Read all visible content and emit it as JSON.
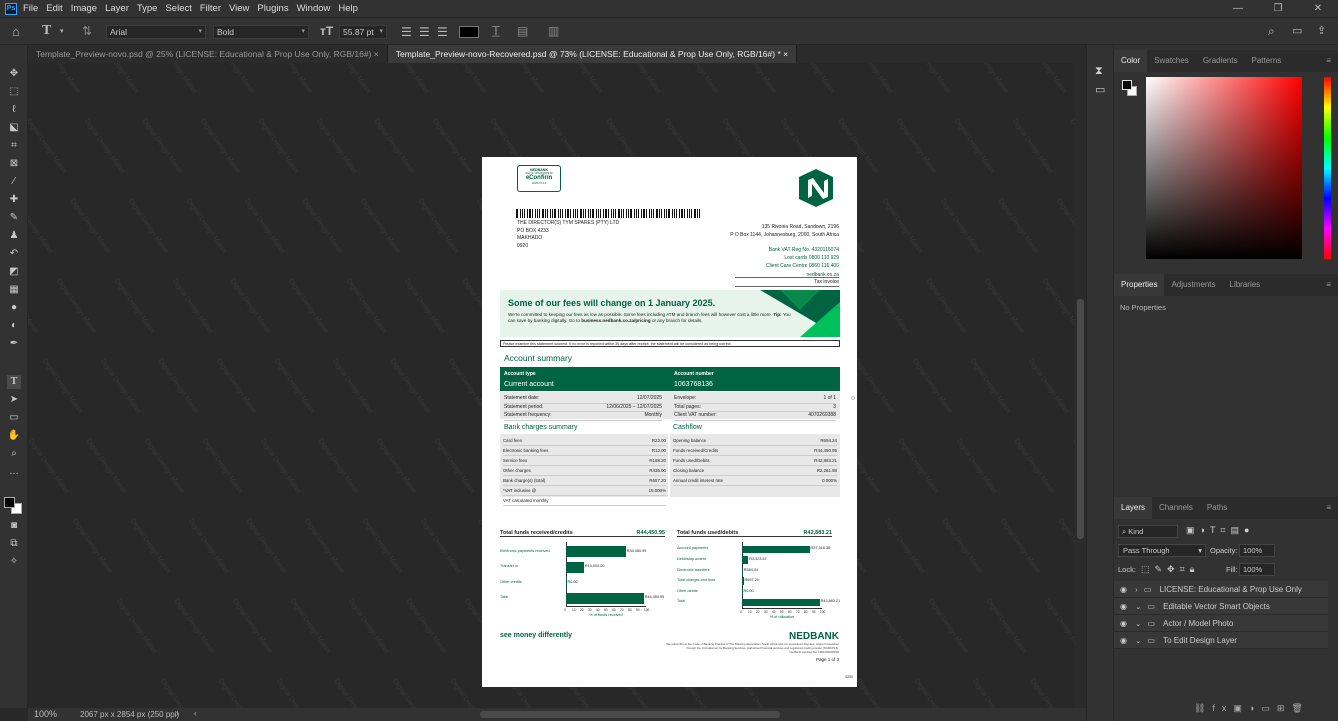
{
  "menubar": {
    "items": [
      "File",
      "Edit",
      "Image",
      "Layer",
      "Type",
      "Select",
      "Filter",
      "View",
      "Plugins",
      "Window",
      "Help"
    ]
  },
  "options": {
    "font_family": "Arial",
    "font_style": "Bold",
    "font_size": "55.87 pt",
    "text_color": "#000000"
  },
  "tabs": [
    {
      "label": "Template_Preview-novo.psd @ 25% (LICENSE: Educational & Prop Use Only, RGB/16#)",
      "close": "×"
    },
    {
      "label": "Template_Preview-novo-Recovered.psd @ 73% (LICENSE: Educational & Prop Use Only, RGB/16#) *",
      "close": "×"
    }
  ],
  "status": {
    "zoom": "100%",
    "doc_info": "2067 px x 2854 px (250 ppi)"
  },
  "watermark": "Digital Design Maker",
  "panels": {
    "color_tabs": [
      "Color",
      "Swatches",
      "Gradients",
      "Patterns"
    ],
    "props_tabs": [
      "Properties",
      "Adjustments",
      "Libraries"
    ],
    "props_empty": "No Properties",
    "layers_tabs": [
      "Layers",
      "Channels",
      "Paths"
    ],
    "kind": "Kind",
    "blend": "Pass Through",
    "opacity_label": "Opacity:",
    "opacity": "100%",
    "lock_label": "Lock:",
    "fill_label": "Fill:",
    "fill": "100%",
    "layers": [
      "LICENSE: Educational & Prop Use Only",
      "Editable Vector Smart Objects",
      "Actor / Model Photo",
      "To Edit Design Layer"
    ]
  },
  "document": {
    "badge_bank": "NEDBANK",
    "badge_sub": "Reg No 1951/000009/06",
    "badge_title": "eConfirm",
    "badge_date": "2025-07-15",
    "recipient": [
      "THE DIRECTOR(S) TYM SPARES (PTY) LTD",
      "PO BOX 4233",
      "MAKHADO",
      "0920"
    ],
    "bank_address": [
      "135 Rivonia Road, Sandown, 2196",
      "P O Box 1144, Johannesburg, 2000, South Africa"
    ],
    "bank_contacts": [
      "Bank VAT Reg No. 4320116074",
      "Lost cards 0800 110 929",
      "Client Care Centre 0860 116 400",
      "nedbank.co.za"
    ],
    "tax_invoice": "Tax invoice",
    "banner_title": "Some of our fees will change on 1 January 2025.",
    "banner_text_1": "We're committed to keeping our fees as low as possible. Some fees including ATM and branch fees will however cost a little more.",
    "banner_tip_label": "Tip:",
    "banner_text_2": "You can save by banking digitally. Go to",
    "banner_link": "business.nedbank.co.za/pricing",
    "banner_text_3": "or any branch for details.",
    "notice": "Please examine this statement soonest. If no error is reported within 30 days after receipt, the statement will be considered as being correct.",
    "acct_summary_title": "Account summary",
    "acct_type_label": "Account type",
    "acct_type": "Current account",
    "acct_num_label": "Account number",
    "acct_num": "1063768136",
    "stmt_left": [
      [
        "Statement date:",
        "12/07/2025"
      ],
      [
        "Statement period:",
        "12/06/2025 – 12/07/2025"
      ],
      [
        "Statement frequency:",
        "Monthly"
      ]
    ],
    "stmt_right": [
      [
        "Envelope:",
        "1 of 1"
      ],
      [
        "Total pages:",
        "3"
      ],
      [
        "Client VAT number:",
        "4070269388"
      ]
    ],
    "charges_title": "Bank charges summary",
    "charges": [
      [
        "Card fees",
        "R22.00"
      ],
      [
        "Electronic banking fees",
        "R12.00"
      ],
      [
        "Service fees",
        "R188.20"
      ],
      [
        "Other charges",
        "R435.00"
      ],
      [
        "Bank charge(s) (total)",
        "R657.20"
      ],
      [
        "*VAT inclusive @",
        "15.000%"
      ],
      [
        "VAT calculated monthly",
        ""
      ]
    ],
    "cashflow_title": "Cashflow",
    "cashflow": [
      [
        "Opening balance",
        "R694.24"
      ],
      [
        "Funds received/Credits",
        "R44,450.95"
      ],
      [
        "Funds used/Debits",
        "R42,883.21"
      ],
      [
        "Closing balance",
        "R2,261.98"
      ],
      [
        "Annual credit interest rate",
        "0.000%"
      ]
    ],
    "credits_title": "Total funds received/credits",
    "credits_total": "R44,450.95",
    "credits_xlabel": "% of funds received",
    "credits_ticks": [
      "0",
      "10",
      "20",
      "30",
      "40",
      "50",
      "60",
      "70",
      "80",
      "90",
      "100"
    ],
    "debits_title": "Total funds used/debits",
    "debits_total": "R42,883.21",
    "debits_xlabel": "% of utilisation",
    "debits_ticks": [
      "0",
      "10",
      "20",
      "30",
      "40",
      "50",
      "60",
      "70",
      "80",
      "90",
      "100"
    ],
    "slogan": "see money differently",
    "footer_brand": "NEDBANK",
    "footer_legal": [
      "We subscribe to the Code of Banking Practice of The Banking Association South Africa and, for unresolved disputes, support resolution",
      "through the Ombudsman for Banking Services. Authorised financial services and registered credit provider (NCRCP16).",
      "Nedbank Ltd Reg No. 1951/000009/06"
    ],
    "page": "Page 1 of 3",
    "code": "0200"
  },
  "chart_data": [
    {
      "type": "bar",
      "title": "Total funds received/credits",
      "xlabel": "% of funds received",
      "xlim": [
        0,
        100
      ],
      "categories": [
        "Electronic payments received",
        "Transfer in",
        "Other credits",
        "Total"
      ],
      "values": [
        77,
        23,
        0,
        100
      ],
      "labels": [
        "R34,450.95",
        "R10,000.00",
        "R0.00",
        "R44,450.95"
      ]
    },
    {
      "type": "bar",
      "title": "Total funds used/debits",
      "xlabel": "% of utilisation",
      "xlim": [
        0,
        100
      ],
      "categories": [
        "Account payments",
        "Debit/stop orders",
        "Electronic transfers",
        "Total charges and fees",
        "Other debits",
        "Total"
      ],
      "values": [
        87,
        8,
        1,
        2,
        0,
        100
      ],
      "labels": [
        "R37,318.38",
        "R3,323.67",
        "R584.04",
        "R657.20",
        "R0.00",
        "R42,883.21"
      ]
    }
  ],
  "colors": {
    "brand_green": "#006341",
    "bright_green": "#00c05a",
    "ps_blue": "#31a8ff"
  }
}
